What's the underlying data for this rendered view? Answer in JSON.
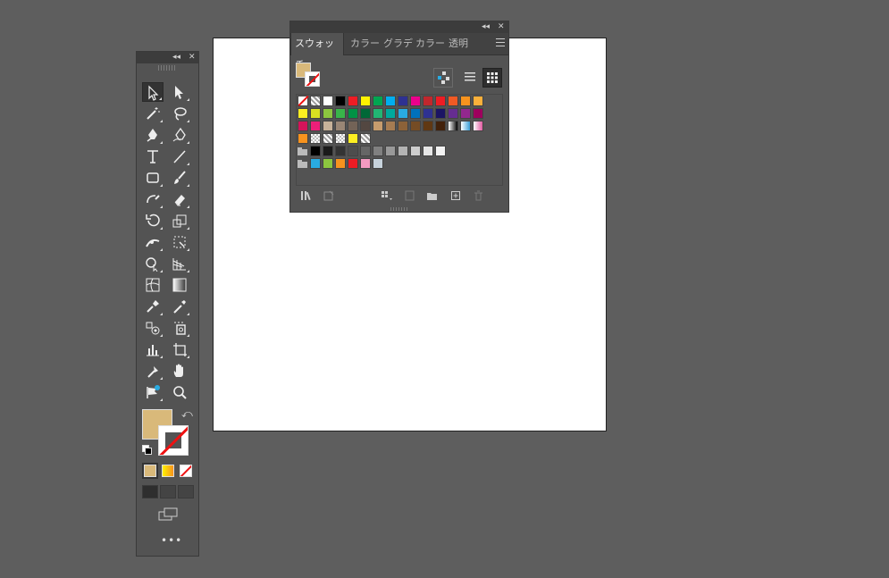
{
  "tools_panel": {
    "collapse_glyph": "◂◂",
    "close_glyph": "✕",
    "more_glyph": "•••",
    "swap_glyph": "⤺",
    "tools": [
      {
        "name": "selection-tool-icon",
        "row": 0,
        "col": 0,
        "selected": true
      },
      {
        "name": "direct-selection-tool-icon",
        "row": 0,
        "col": 1
      },
      {
        "name": "magic-wand-tool-icon",
        "row": 1,
        "col": 0
      },
      {
        "name": "lasso-tool-icon",
        "row": 1,
        "col": 1
      },
      {
        "name": "pen-tool-icon",
        "row": 2,
        "col": 0
      },
      {
        "name": "curvature-tool-icon",
        "row": 2,
        "col": 1
      },
      {
        "name": "type-tool-icon",
        "row": 3,
        "col": 0
      },
      {
        "name": "line-segment-tool-icon",
        "row": 3,
        "col": 1
      },
      {
        "name": "rectangle-tool-icon",
        "row": 4,
        "col": 0
      },
      {
        "name": "paintbrush-tool-icon",
        "row": 4,
        "col": 1
      },
      {
        "name": "shaper-tool-icon",
        "row": 5,
        "col": 0
      },
      {
        "name": "eraser-tool-icon",
        "row": 5,
        "col": 1
      },
      {
        "name": "rotate-tool-icon",
        "row": 6,
        "col": 0
      },
      {
        "name": "scale-tool-icon",
        "row": 6,
        "col": 1
      },
      {
        "name": "width-tool-icon",
        "row": 7,
        "col": 0
      },
      {
        "name": "free-transform-tool-icon",
        "row": 7,
        "col": 1
      },
      {
        "name": "shape-builder-tool-icon",
        "row": 8,
        "col": 0
      },
      {
        "name": "perspective-grid-tool-icon",
        "row": 8,
        "col": 1
      },
      {
        "name": "mesh-tool-icon",
        "row": 9,
        "col": 0
      },
      {
        "name": "gradient-tool-icon",
        "row": 9,
        "col": 1
      },
      {
        "name": "blend-tool-icon",
        "row": 10,
        "col": 0
      },
      {
        "name": "eyedropper-tool-icon",
        "row": 10,
        "col": 1
      },
      {
        "name": "symbol-sprayer-tool-icon",
        "row": 11,
        "col": 0
      },
      {
        "name": "live-paint-bucket-icon",
        "row": 11,
        "col": 1
      },
      {
        "name": "column-graph-tool-icon",
        "row": 12,
        "col": 0
      },
      {
        "name": "artboard-tool-icon",
        "row": 12,
        "col": 1
      },
      {
        "name": "slice-tool-icon",
        "row": 13,
        "col": 0
      },
      {
        "name": "hand-tool-icon",
        "row": 13,
        "col": 1
      },
      {
        "name": "puppet-warp-tool-icon",
        "row": 14,
        "col": 0
      },
      {
        "name": "zoom-tool-icon",
        "row": 14,
        "col": 1
      }
    ],
    "fill_color": "#d9b97a"
  },
  "swatches_panel": {
    "collapse_glyph": "◂◂",
    "close_glyph": "✕",
    "tabs": [
      {
        "label": "スウォッチ",
        "active": true
      },
      {
        "label": "カラー"
      },
      {
        "label": "グラデ"
      },
      {
        "label": "カラー"
      },
      {
        "label": "透明"
      }
    ],
    "rows": [
      [
        "none",
        "pattern",
        "#ffffff",
        "#000000",
        "#ee1c24",
        "#fff200",
        "#00a651",
        "#00aeef",
        "#2e3192",
        "#ec008c",
        "#c1272d",
        "#ed1c24",
        "#f15a24",
        "#f7931e",
        "#fbb03b"
      ],
      [
        "#fcee21",
        "#d9e021",
        "#8cc63f",
        "#39b54a",
        "#009245",
        "#006837",
        "#22b573",
        "#00a99d",
        "#29abe2",
        "#0071bc",
        "#2e3192",
        "#1b1464",
        "#662d91",
        "#93278f",
        "#9e005d"
      ],
      [
        "#d4145a",
        "#ed1e79",
        "#c7b299",
        "#998675",
        "#736357",
        "#534741",
        "#c69c6d",
        "#a67c52",
        "#8c6239",
        "#754c24",
        "#603813",
        "#42210b",
        "grad-bw",
        "grad-blue",
        "grad-pink"
      ],
      [
        "#f7931e",
        "check",
        "pattern",
        "check",
        "#fcee21",
        "pattern"
      ],
      [
        "folder",
        "#000000",
        "#1a1a1a",
        "#333333",
        "#4d4d4d",
        "#666666",
        "#808080",
        "#999999",
        "#b3b3b3",
        "#cccccc",
        "#e6e6e6",
        "#f2f2f2"
      ],
      [
        "folder",
        "#29abe2",
        "#8cc63f",
        "#f7931e",
        "#ed1c24",
        "#f49ac1",
        "#c7d3dc"
      ]
    ]
  }
}
